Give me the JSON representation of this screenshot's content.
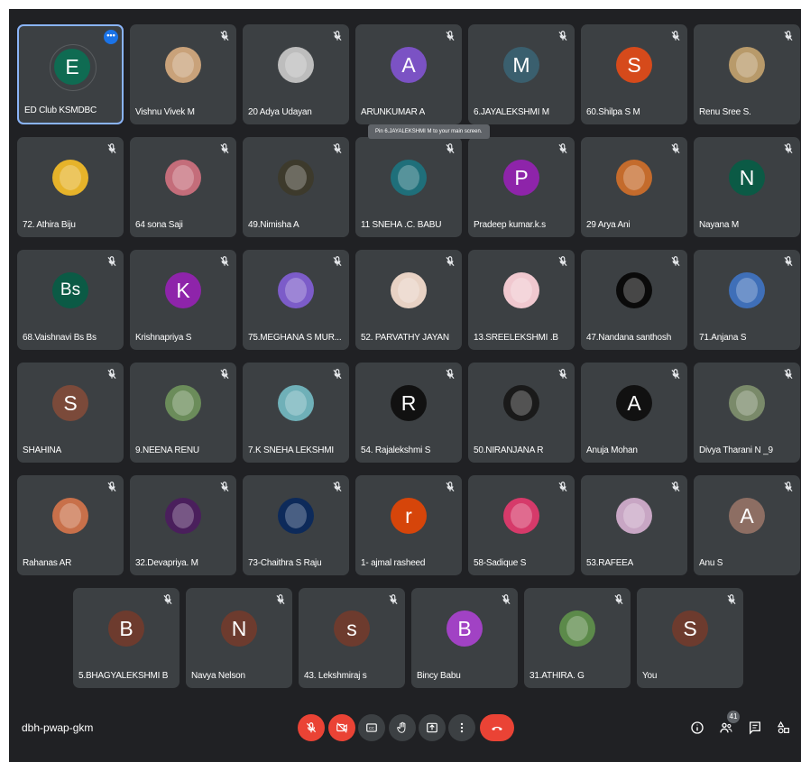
{
  "tooltip": "Pin 6.JAYALEKSHMI M to your main screen.",
  "meeting_code": "dbh-pwap-gkm",
  "people_count": "41",
  "participants": [
    {
      "name": "ED Club KSMDBC",
      "initial": "E",
      "color": "#0f6b52",
      "type": "letter",
      "active": true
    },
    {
      "name": "Vishnu Vivek M",
      "initial": "",
      "color": "#c9a27a",
      "type": "photo"
    },
    {
      "name": "20 Adya Udayan",
      "initial": "",
      "color": "#bdbdbd",
      "type": "photo"
    },
    {
      "name": "ARUNKUMAR A",
      "initial": "A",
      "color": "#7b52c4",
      "type": "letter"
    },
    {
      "name": "6.JAYALEKSHMI M",
      "initial": "M",
      "color": "#3a5f6e",
      "type": "letter"
    },
    {
      "name": "60.Shilpa S M",
      "initial": "S",
      "color": "#d64a1b",
      "type": "letter"
    },
    {
      "name": "Renu Sree S.",
      "initial": "",
      "color": "#b89a6a",
      "type": "photo"
    },
    {
      "name": "72. Athira Biju",
      "initial": "",
      "color": "#e6b32a",
      "type": "photo"
    },
    {
      "name": "64 sona Saji",
      "initial": "",
      "color": "#c46d7a",
      "type": "photo"
    },
    {
      "name": "49.Nimisha A",
      "initial": "",
      "color": "#3d3a2c",
      "type": "photo"
    },
    {
      "name": "11 SNEHA .C. BABU",
      "initial": "",
      "color": "#1f6f7a",
      "type": "photo"
    },
    {
      "name": "Pradeep kumar.k.s",
      "initial": "P",
      "color": "#8e24aa",
      "type": "letter"
    },
    {
      "name": "29 Arya Ani",
      "initial": "",
      "color": "#c46b2c",
      "type": "photo"
    },
    {
      "name": "Nayana M",
      "initial": "N",
      "color": "#0b5a45",
      "type": "letter"
    },
    {
      "name": "68.Vaishnavi Bs Bs",
      "initial": "Bs",
      "color": "#0b5a45",
      "type": "letter"
    },
    {
      "name": "Krishnapriya S",
      "initial": "K",
      "color": "#8e24aa",
      "type": "letter"
    },
    {
      "name": "75.MEGHANA S MUR...",
      "initial": "",
      "color": "#7c5cc9",
      "type": "photo"
    },
    {
      "name": "52. PARVATHY JAYAN",
      "initial": "",
      "color": "#e8d2c4",
      "type": "photo"
    },
    {
      "name": "13.SREELEKSHMI .B",
      "initial": "",
      "color": "#f0c8cf",
      "type": "photo"
    },
    {
      "name": "47.Nandana santhosh",
      "initial": "",
      "color": "#0a0a0a",
      "type": "photo"
    },
    {
      "name": "71.Anjana S",
      "initial": "",
      "color": "#3f6fb8",
      "type": "photo"
    },
    {
      "name": "SHAHINA",
      "initial": "S",
      "color": "#7b4a3a",
      "type": "letter"
    },
    {
      "name": "9.NEENA RENU",
      "initial": "",
      "color": "#6b8c5a",
      "type": "photo"
    },
    {
      "name": "7.K SNEHA LEKSHMI",
      "initial": "",
      "color": "#6fb0b8",
      "type": "photo"
    },
    {
      "name": "54. Rajalekshmi S",
      "initial": "R",
      "color": "#111111",
      "type": "letter"
    },
    {
      "name": "50.NIRANJANA R",
      "initial": "",
      "color": "#1a1a1a",
      "type": "photo"
    },
    {
      "name": "Anuja Mohan",
      "initial": "A",
      "color": "#111111",
      "type": "letter"
    },
    {
      "name": "Divya Tharani N _9",
      "initial": "",
      "color": "#7a8a6a",
      "type": "photo"
    },
    {
      "name": "Rahanas AR",
      "initial": "",
      "color": "#c8704a",
      "type": "photo"
    },
    {
      "name": "32.Devapriya. M",
      "initial": "",
      "color": "#4a1f5c",
      "type": "photo"
    },
    {
      "name": "73-Chaithra S Raju",
      "initial": "",
      "color": "#0d2a5a",
      "type": "photo"
    },
    {
      "name": "1- ajmal rasheed",
      "initial": "r",
      "color": "#d6450a",
      "type": "letter"
    },
    {
      "name": "58-Sadique S",
      "initial": "",
      "color": "#d63a6a",
      "type": "photo"
    },
    {
      "name": "53.RAFEEA",
      "initial": "",
      "color": "#c8a6c4",
      "type": "photo"
    },
    {
      "name": "Anu S",
      "initial": "A",
      "color": "#8d6e63",
      "type": "letter"
    },
    {
      "name": "5.BHAGYALEKSHMI B",
      "initial": "B",
      "color": "#6d3b2e",
      "type": "letter"
    },
    {
      "name": "Navya Nelson",
      "initial": "N",
      "color": "#6d3b2e",
      "type": "letter"
    },
    {
      "name": "43. Lekshmiraj s",
      "initial": "s",
      "color": "#6d3b2e",
      "type": "letter"
    },
    {
      "name": "Bincy Babu",
      "initial": "B",
      "color": "#a142c4",
      "type": "letter"
    },
    {
      "name": "31.ATHIRA. G",
      "initial": "",
      "color": "#5c8a4a",
      "type": "photo"
    },
    {
      "name": "You",
      "initial": "S",
      "color": "#6d3b2e",
      "type": "letter"
    }
  ]
}
